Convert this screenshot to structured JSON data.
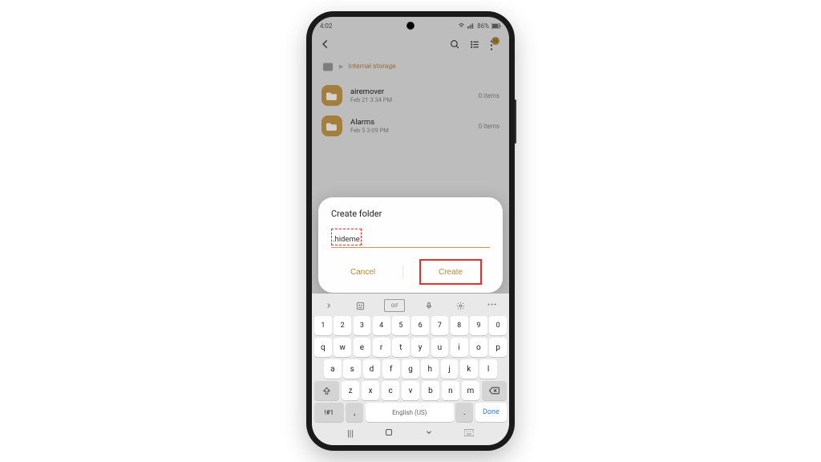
{
  "status": {
    "time": "4:02",
    "battery_pct": "86%"
  },
  "breadcrumb": {
    "label": "Internal storage"
  },
  "files": [
    {
      "name": "airemover",
      "date": "Feb 21 3:34 PM",
      "count": "0 items"
    },
    {
      "name": "Alarms",
      "date": "Feb 5 3:09 PM",
      "count": "0 items"
    }
  ],
  "dialog": {
    "title": "Create folder",
    "input_value": ".hideme",
    "cancel": "Cancel",
    "create": "Create"
  },
  "keyboard": {
    "numbers": [
      "1",
      "2",
      "3",
      "4",
      "5",
      "6",
      "7",
      "8",
      "9",
      "0"
    ],
    "row1": [
      "q",
      "w",
      "e",
      "r",
      "t",
      "y",
      "u",
      "i",
      "o",
      "p"
    ],
    "row2": [
      "a",
      "s",
      "d",
      "f",
      "g",
      "h",
      "j",
      "k",
      "l"
    ],
    "row3": [
      "z",
      "x",
      "c",
      "v",
      "b",
      "n",
      "m"
    ],
    "sym": "!#1",
    "lang": "English (US)",
    "done": "Done",
    "comma": ",",
    "period": "."
  }
}
